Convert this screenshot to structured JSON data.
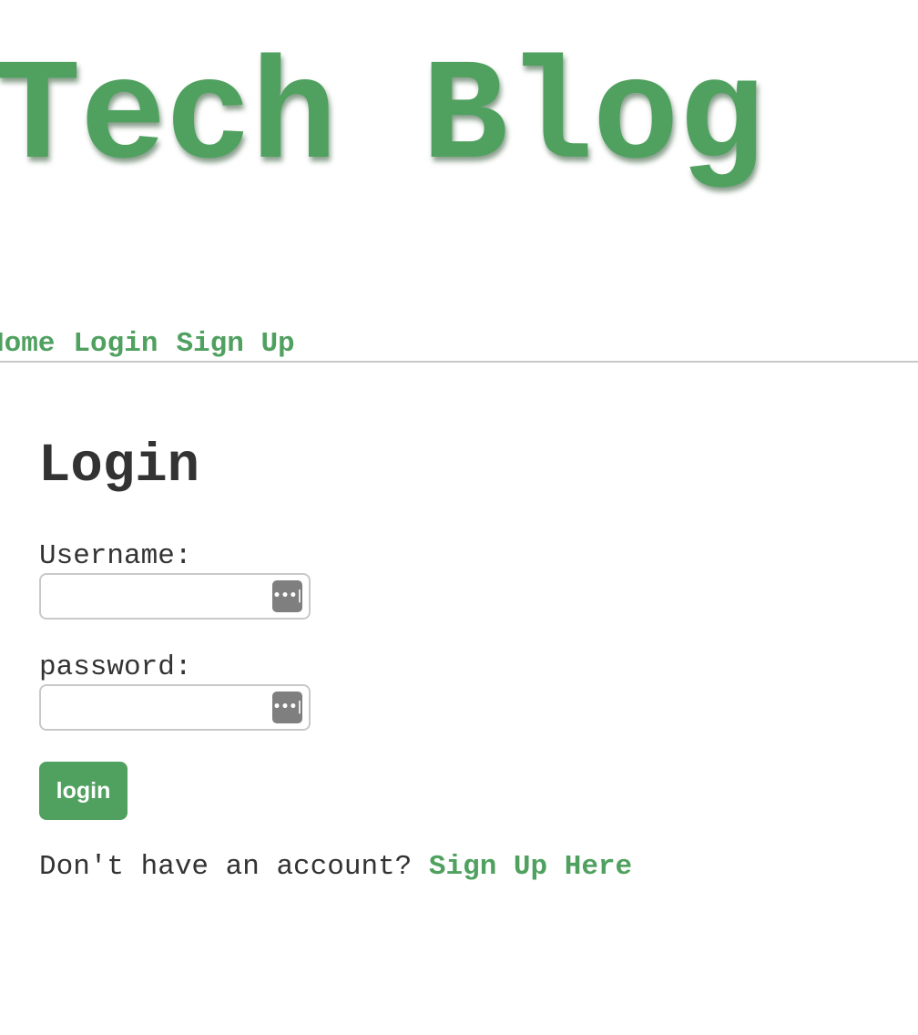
{
  "header": {
    "site_title": "Tech Blog"
  },
  "nav": {
    "items": [
      {
        "label": "Home"
      },
      {
        "label": "Login"
      },
      {
        "label": "Sign Up"
      }
    ]
  },
  "login_form": {
    "heading": "Login",
    "username_label": "Username:",
    "username_value": "",
    "password_label": "password:",
    "password_value": "",
    "key_icon_glyph": "•••|",
    "submit_label": "login"
  },
  "signup_prompt": {
    "text": "Don't have an account?",
    "link_label": "Sign Up Here"
  },
  "colors": {
    "accent": "#50a160",
    "text": "#333333",
    "divider": "#c8c8c8",
    "field_border": "#c9c9c9",
    "key_icon_bg": "#7f7f7f"
  },
  "icons": {
    "field_autofill": "password-manager-key-icon"
  }
}
